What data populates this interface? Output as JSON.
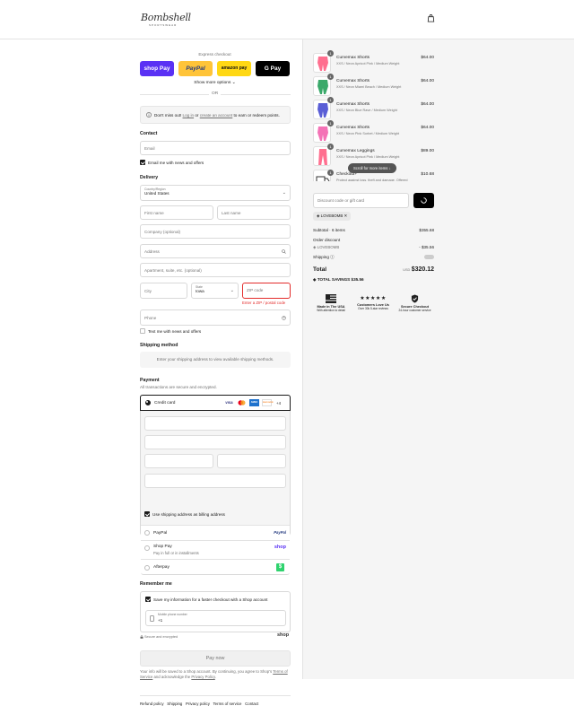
{
  "brand": {
    "name": "Bombshell",
    "tagline": "SPORTSWEAR"
  },
  "express": {
    "label": "Express checkout",
    "shop_pay": "shop Pay",
    "paypal": "PayPal",
    "amazon_pay": "amazon pay",
    "google_pay": "G Pay",
    "show_more": "Show more options",
    "or": "OR"
  },
  "login_banner": {
    "prefix": "Don't miss out!",
    "login": "Log in",
    "or": "or",
    "create": "create an account",
    "suffix": "to earn or redeem points."
  },
  "contact": {
    "heading": "Contact",
    "email_placeholder": "Email",
    "email_news": "Email me with news and offers"
  },
  "delivery": {
    "heading": "Delivery",
    "country_label": "Country/Region",
    "country_value": "United States",
    "first_name": "First name",
    "last_name": "Last name",
    "company": "Company (optional)",
    "address": "Address",
    "apartment": "Apartment, suite, etc. (optional)",
    "city": "City",
    "state_label": "State",
    "state_value": "Iowa",
    "zip": "ZIP code",
    "zip_error": "Enter a ZIP / postal code",
    "phone": "Phone",
    "text_news": "Text me with news and offers"
  },
  "shipping_method": {
    "heading": "Shipping method",
    "notice": "Enter your shipping address to view available shipping methods."
  },
  "payment": {
    "heading": "Payment",
    "subtitle": "All transactions are secure and encrypted.",
    "credit_card": "Credit card",
    "card_more": "+4",
    "billing_same": "Use shipping address as billing address",
    "paypal": "PayPal",
    "shop_pay": "Shop Pay",
    "shop_pay_sub": "Pay in full or in installments",
    "shop_logo": "shop",
    "afterpay": "Afterpay"
  },
  "remember": {
    "heading": "Remember me",
    "save_info": "Save my information for a faster checkout with a Shop account",
    "mobile_label": "Mobile phone number",
    "mobile_value": "+1",
    "secure": "Secure and encrypted",
    "shop_logo": "shop"
  },
  "pay_now": "Pay now",
  "terms": {
    "text1": "Your info will be saved to a Shop account. By continuing, you agree to Shop's",
    "terms_link": "Terms of Service",
    "text2": "and acknowledge the",
    "privacy_link": "Privacy Policy"
  },
  "footer": [
    "Refund policy",
    "Shipping",
    "Privacy policy",
    "Terms of service",
    "Contact"
  ],
  "cart": {
    "items": [
      {
        "name": "Curvemax Shorts",
        "variant": "XXS / Neon Apricot Pink / Medium Weight",
        "price": "$64.00",
        "qty": "1",
        "color": "#ff6f8f"
      },
      {
        "name": "Curvemax Shorts",
        "variant": "XXS / Neon Miami Beach / Medium Weight",
        "price": "$64.00",
        "qty": "1",
        "color": "#3aa96a"
      },
      {
        "name": "Curvemax Shorts",
        "variant": "XXS / Neon Blue Rave / Medium Weight",
        "price": "$64.00",
        "qty": "1",
        "color": "#5a5ed6"
      },
      {
        "name": "Curvemax Shorts",
        "variant": "XXS / Neon Pink Sorbet / Medium Weight",
        "price": "$64.00",
        "qty": "1",
        "color": "#f472b6"
      },
      {
        "name": "Curvemax Leggings",
        "variant": "XXS / Neon Apricot Pink / Medium Weight",
        "price": "$89.00",
        "qty": "1",
        "color": "#ff6f8f"
      },
      {
        "name": "Checkout+",
        "variant": "Protect against loss, theft and damage. Offered",
        "price": "$10.68",
        "qty": "1",
        "color": "#ffffff"
      }
    ],
    "scroll_hint": "Scroll for more items",
    "discount_placeholder": "Discount code or gift card",
    "discount_code": "LOVEBOMB",
    "subtotal_label": "Subtotal · 6 items",
    "subtotal": "$355.68",
    "order_discount_label": "Order discount",
    "order_discount_code": "LOVEBOMB",
    "order_discount": "- $35.56",
    "shipping_label": "Shipping",
    "total_label": "Total",
    "currency": "USD",
    "total": "$320.12",
    "savings": "TOTAL SAVINGS $35.56"
  },
  "badges": [
    {
      "title": "Made in The USA",
      "sub": "With attention to detail"
    },
    {
      "title": "Customers Love Us",
      "sub": "Over 30k 5-star reviews",
      "stars": "★★★★★"
    },
    {
      "title": "Secure Checkout",
      "sub": "24-hour customer service"
    }
  ],
  "colors": {
    "shop_pay": "#5a31f4",
    "paypal": "#ffc439",
    "amazon": "#ffd814",
    "gpay": "#000000",
    "error": "#e32c2b",
    "afterpay": "#2fd36e"
  }
}
